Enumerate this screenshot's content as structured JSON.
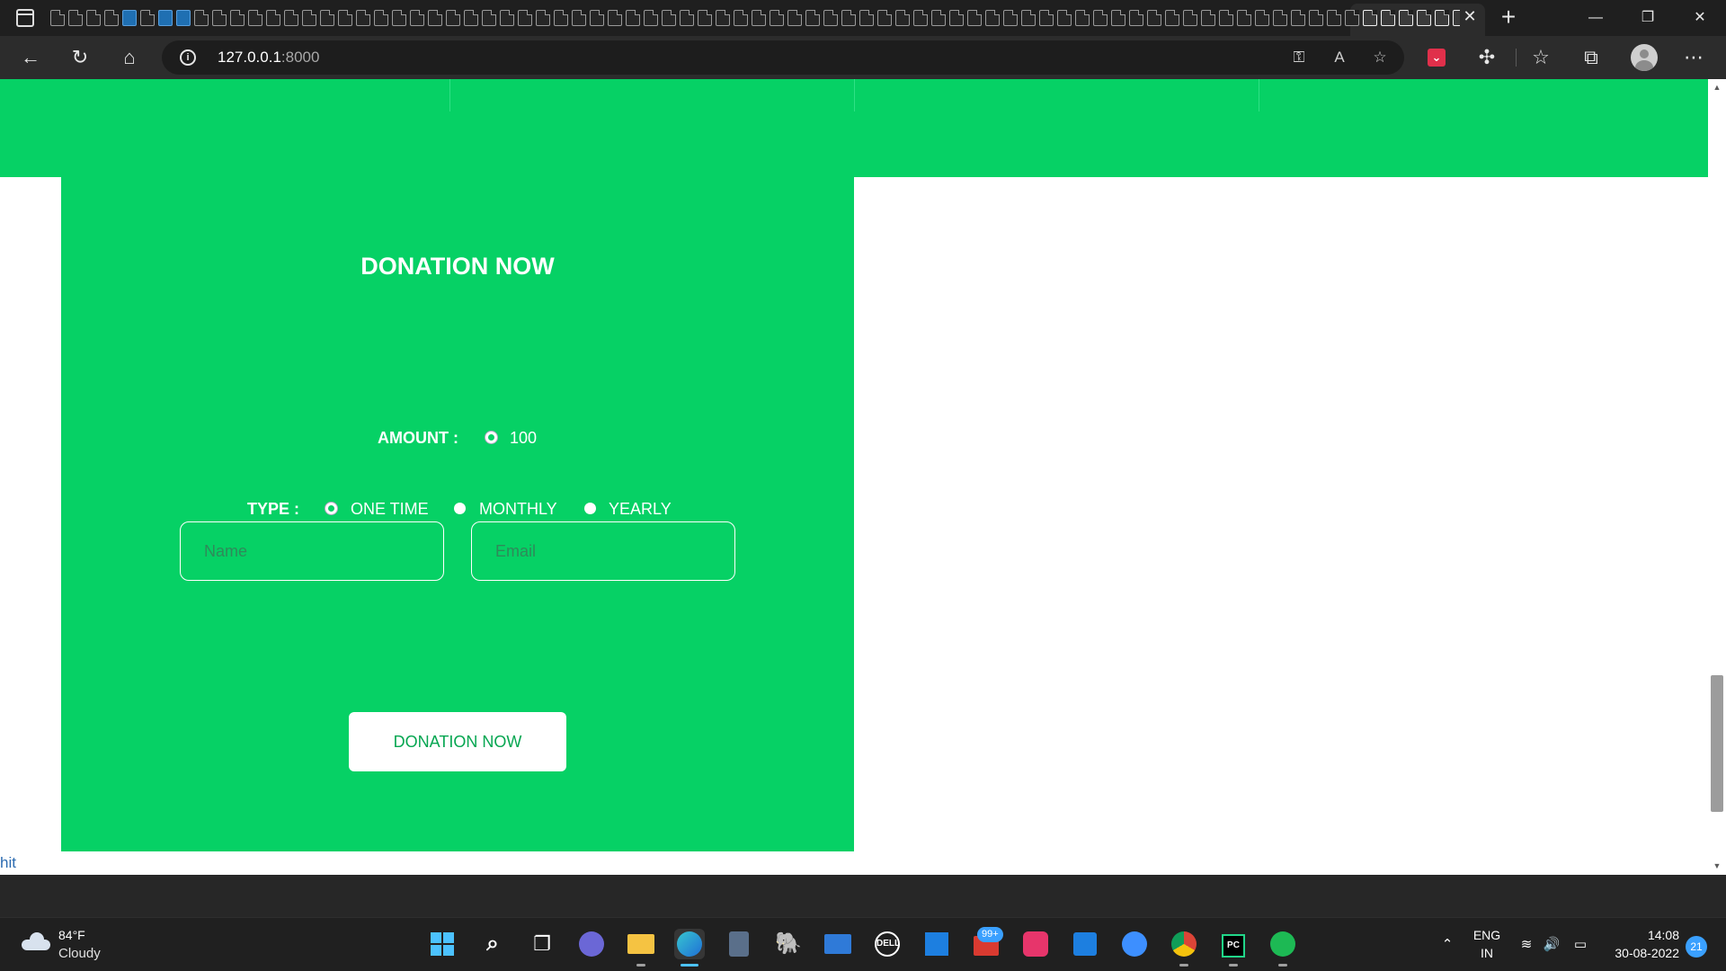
{
  "browser": {
    "address": {
      "host": "127.0.0.1",
      "port": ":8000"
    }
  },
  "page": {
    "title": "DONATION NOW",
    "amount": {
      "label": "AMOUNT :",
      "options": [
        "100"
      ],
      "selected": "100"
    },
    "type": {
      "label": "TYPE :",
      "options": [
        "ONE TIME",
        "MONTHLY",
        "YEARLY"
      ],
      "selected": "ONE TIME"
    },
    "name_field": {
      "placeholder": "Name",
      "value": ""
    },
    "email_field": {
      "placeholder": "Email",
      "value": ""
    },
    "submit_label": "DONATION NOW",
    "stray_text": "hit"
  },
  "taskbar": {
    "weather": {
      "temperature": "84°F",
      "condition": "Cloudy"
    },
    "mail_badge": "99+",
    "language": {
      "line1": "ENG",
      "line2": "IN"
    },
    "clock": {
      "time": "14:08",
      "date": "30-08-2022"
    },
    "notification_count": "21"
  },
  "colors": {
    "brand_green": "#06d165",
    "tab_bar": "#1f1f1f",
    "toolbar": "#2c2c2c",
    "taskbar": "#202020",
    "accent_blue": "#3aa0ff"
  }
}
